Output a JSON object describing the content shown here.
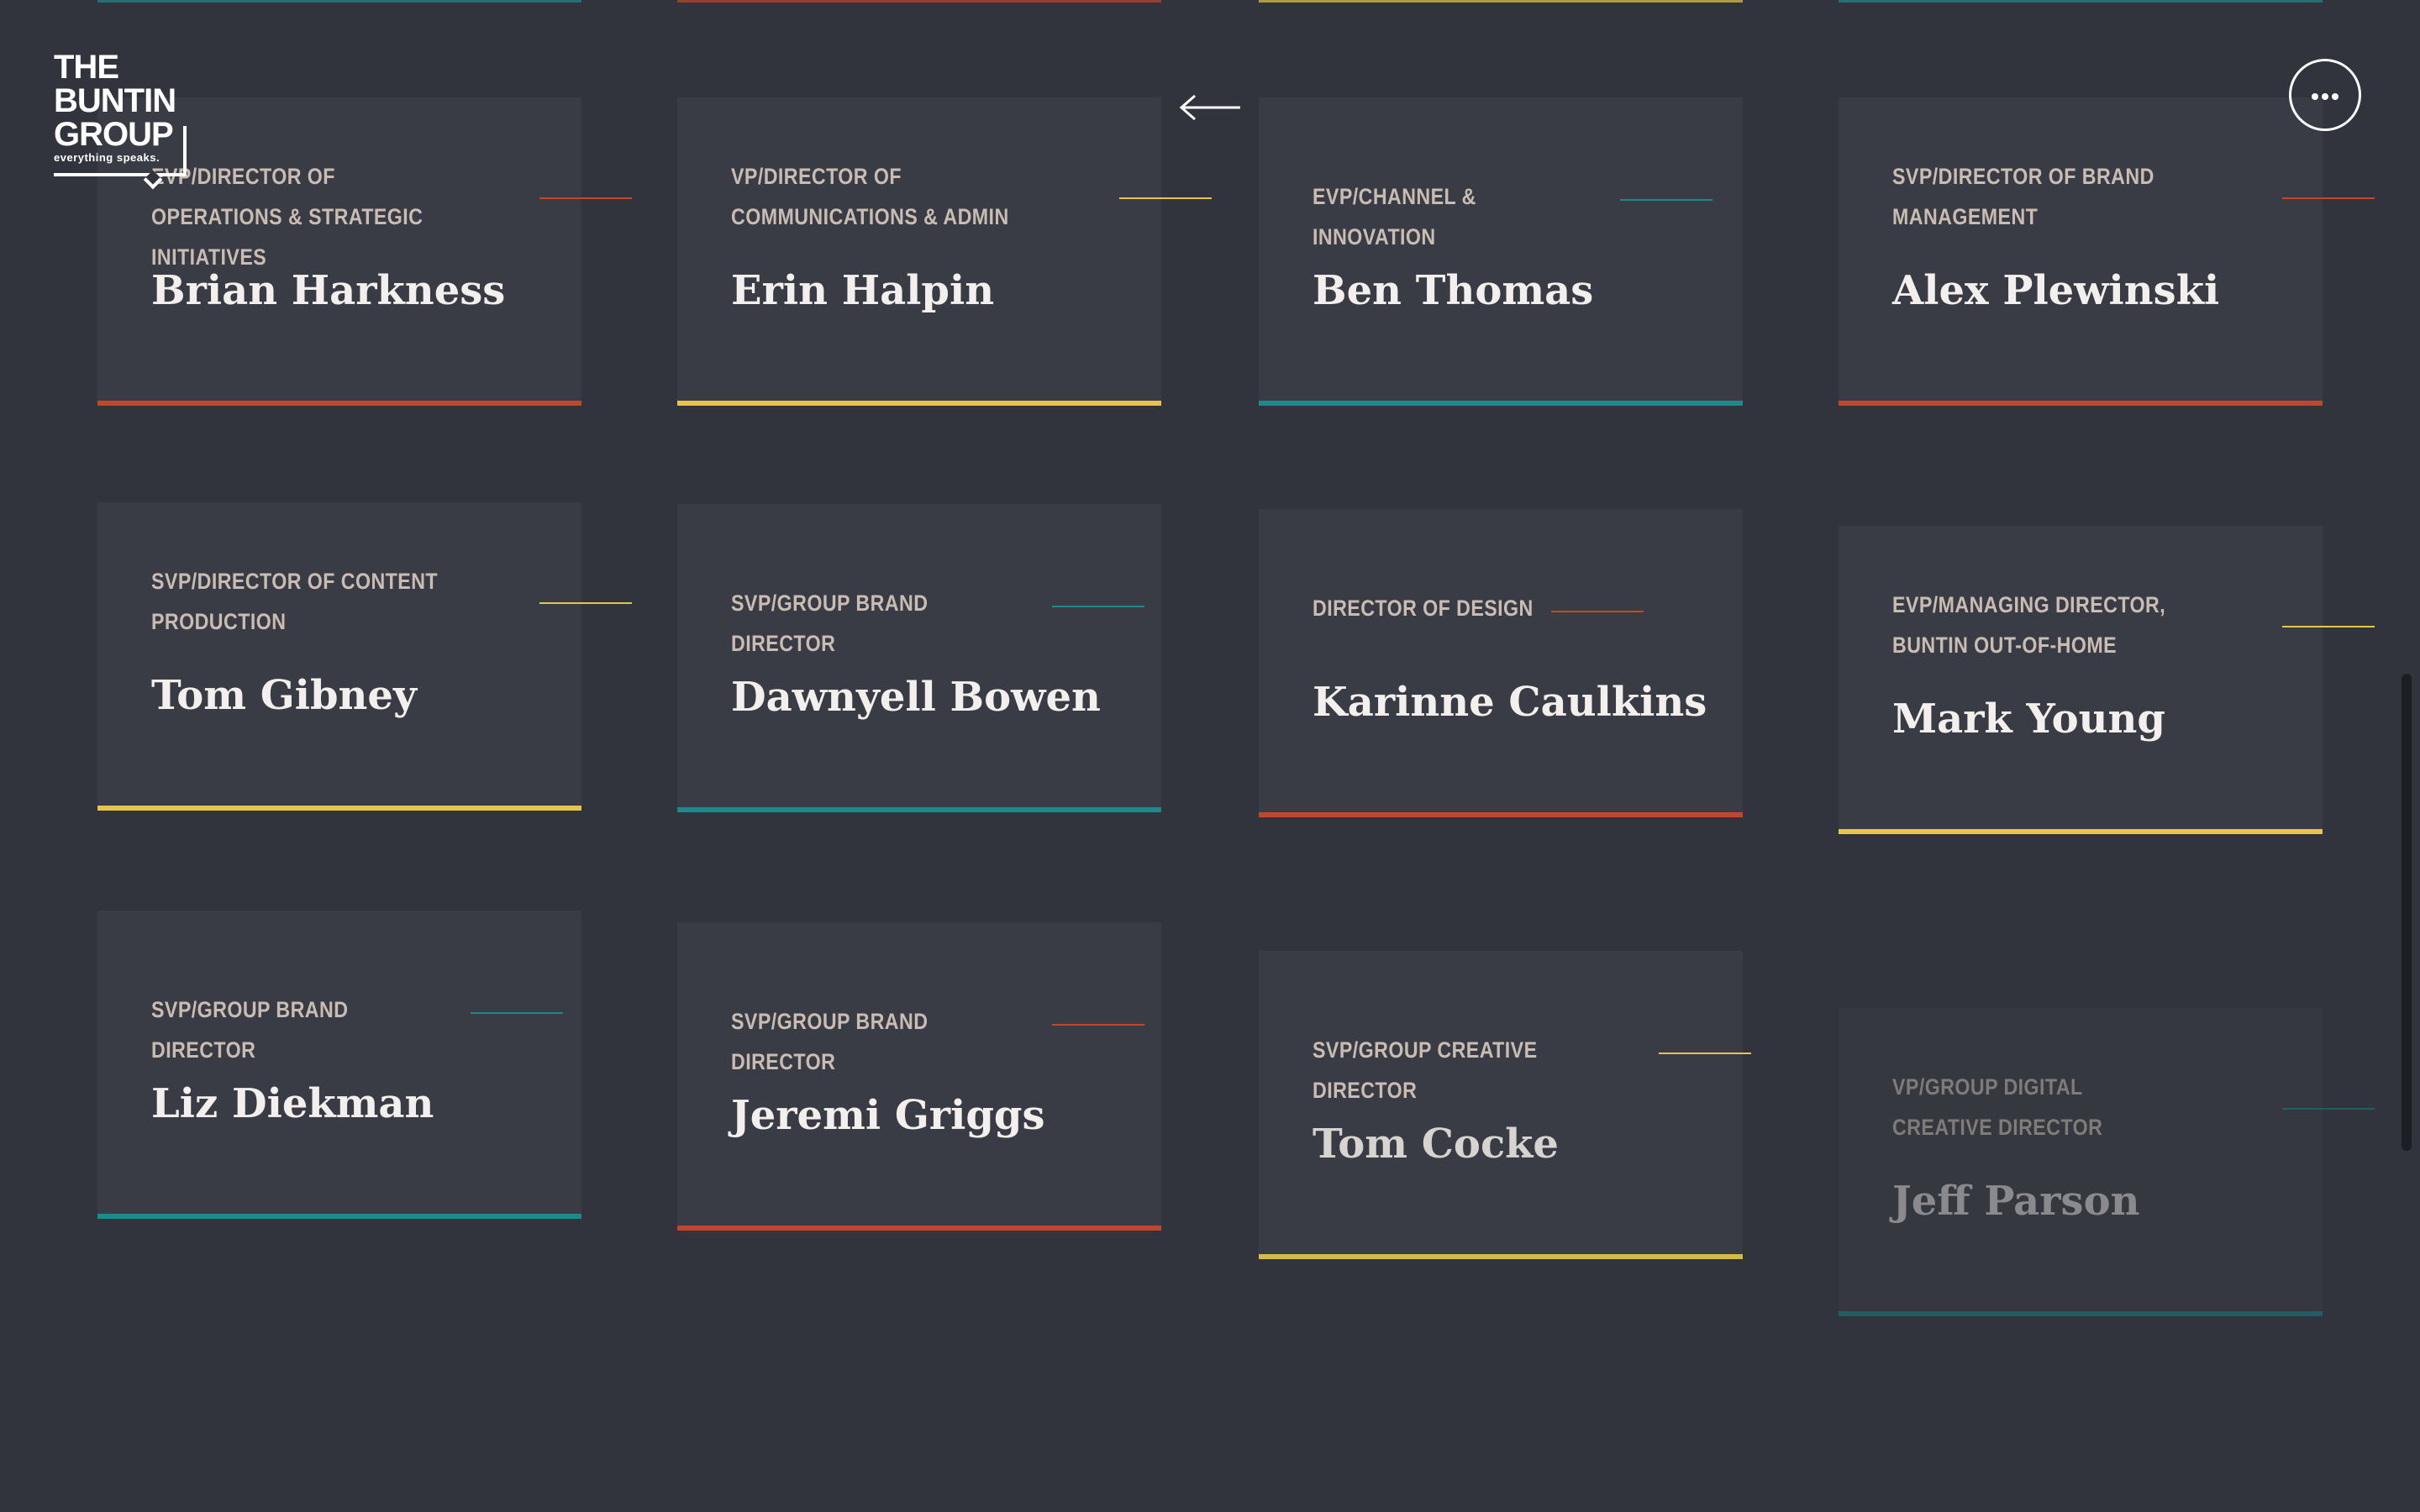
{
  "brand": {
    "logo_line1": "THE",
    "logo_line2": "BUNTIN",
    "logo_line3": "GROUP",
    "tagline": "everything speaks."
  },
  "colors": {
    "background": "#32343d",
    "card": "#3a3c45",
    "red": "#c2462b",
    "yellow": "#e6c54a",
    "teal": "#1b8a8a"
  },
  "nav": {
    "back_icon": "arrow-left-icon",
    "menu_icon": "more-horizontal-icon"
  },
  "people": [
    {
      "title": "EVP/Director of Operations & Strategic Initiatives",
      "name": "Brian Harkness",
      "color": "red"
    },
    {
      "title": "VP/Director of Communications & Admin",
      "name": "Erin Halpin",
      "color": "yellow"
    },
    {
      "title": "EVP/Channel & Innovation",
      "name": "Ben Thomas",
      "color": "teal"
    },
    {
      "title": "SVP/Director of Brand Management",
      "name": "Alex Plewinski",
      "color": "red"
    },
    {
      "title": "SVP/Director of Content Production",
      "name": "Tom Gibney",
      "color": "yellow"
    },
    {
      "title": "SVP/Group Brand Director",
      "name": "Dawnyell Bowen",
      "color": "teal"
    },
    {
      "title": "Director of Design",
      "name": "Karinne Caulkins",
      "color": "red"
    },
    {
      "title": "EVP/Managing Director, Buntin Out-of-Home",
      "name": "Mark Young",
      "color": "yellow"
    },
    {
      "title": "SVP/Group Brand Director",
      "name": "Liz Diekman",
      "color": "teal"
    },
    {
      "title": "SVP/Group Brand Director",
      "name": "Jeremi Griggs",
      "color": "red"
    },
    {
      "title": "SVP/Group Creative Director",
      "name": "Tom Cocke",
      "color": "yellow"
    },
    {
      "title": "VP/Group Digital Creative Director",
      "name": "Jeff Parson",
      "color": "teal"
    }
  ]
}
